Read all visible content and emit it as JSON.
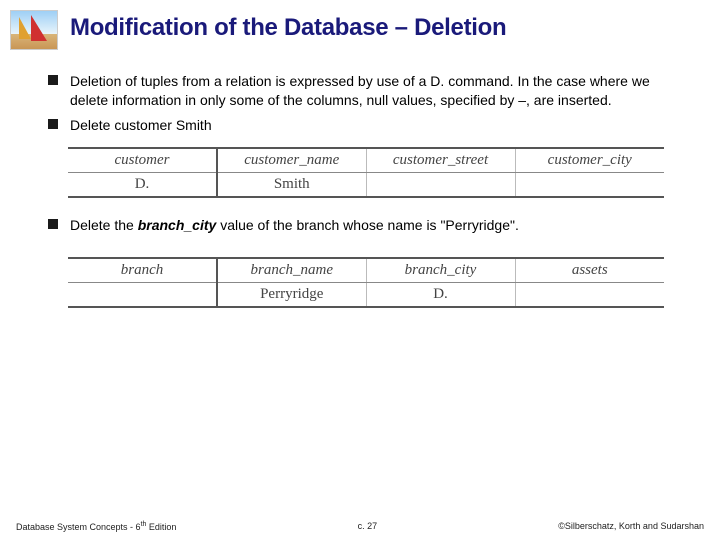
{
  "title": "Modification of the Database – Deletion",
  "bullets": {
    "b1": "Deletion of tuples from a relation is expressed by use of a D. command. In the case where we delete information in only some of the columns, null values, specified by –, are inserted.",
    "b2": "Delete customer Smith",
    "b3_pre": "Delete the ",
    "b3_em": "branch_city",
    "b3_post": " value of the branch whose name is \"Perryridge\"."
  },
  "table1": {
    "headers": {
      "c0": "customer",
      "c1": "customer_name",
      "c2": "customer_street",
      "c3": "customer_city"
    },
    "row": {
      "c0": "D.",
      "c1": "Smith",
      "c2": "",
      "c3": ""
    }
  },
  "table2": {
    "headers": {
      "c0": "branch",
      "c1": "branch_name",
      "c2": "branch_city",
      "c3": "assets"
    },
    "row": {
      "c0": "",
      "c1": "Perryridge",
      "c2": "D.",
      "c3": ""
    }
  },
  "footer": {
    "left_a": "Database System Concepts - 6",
    "left_b": " Edition",
    "sup": "th",
    "center": "c. 27",
    "right": "©Silberschatz, Korth and Sudarshan"
  }
}
